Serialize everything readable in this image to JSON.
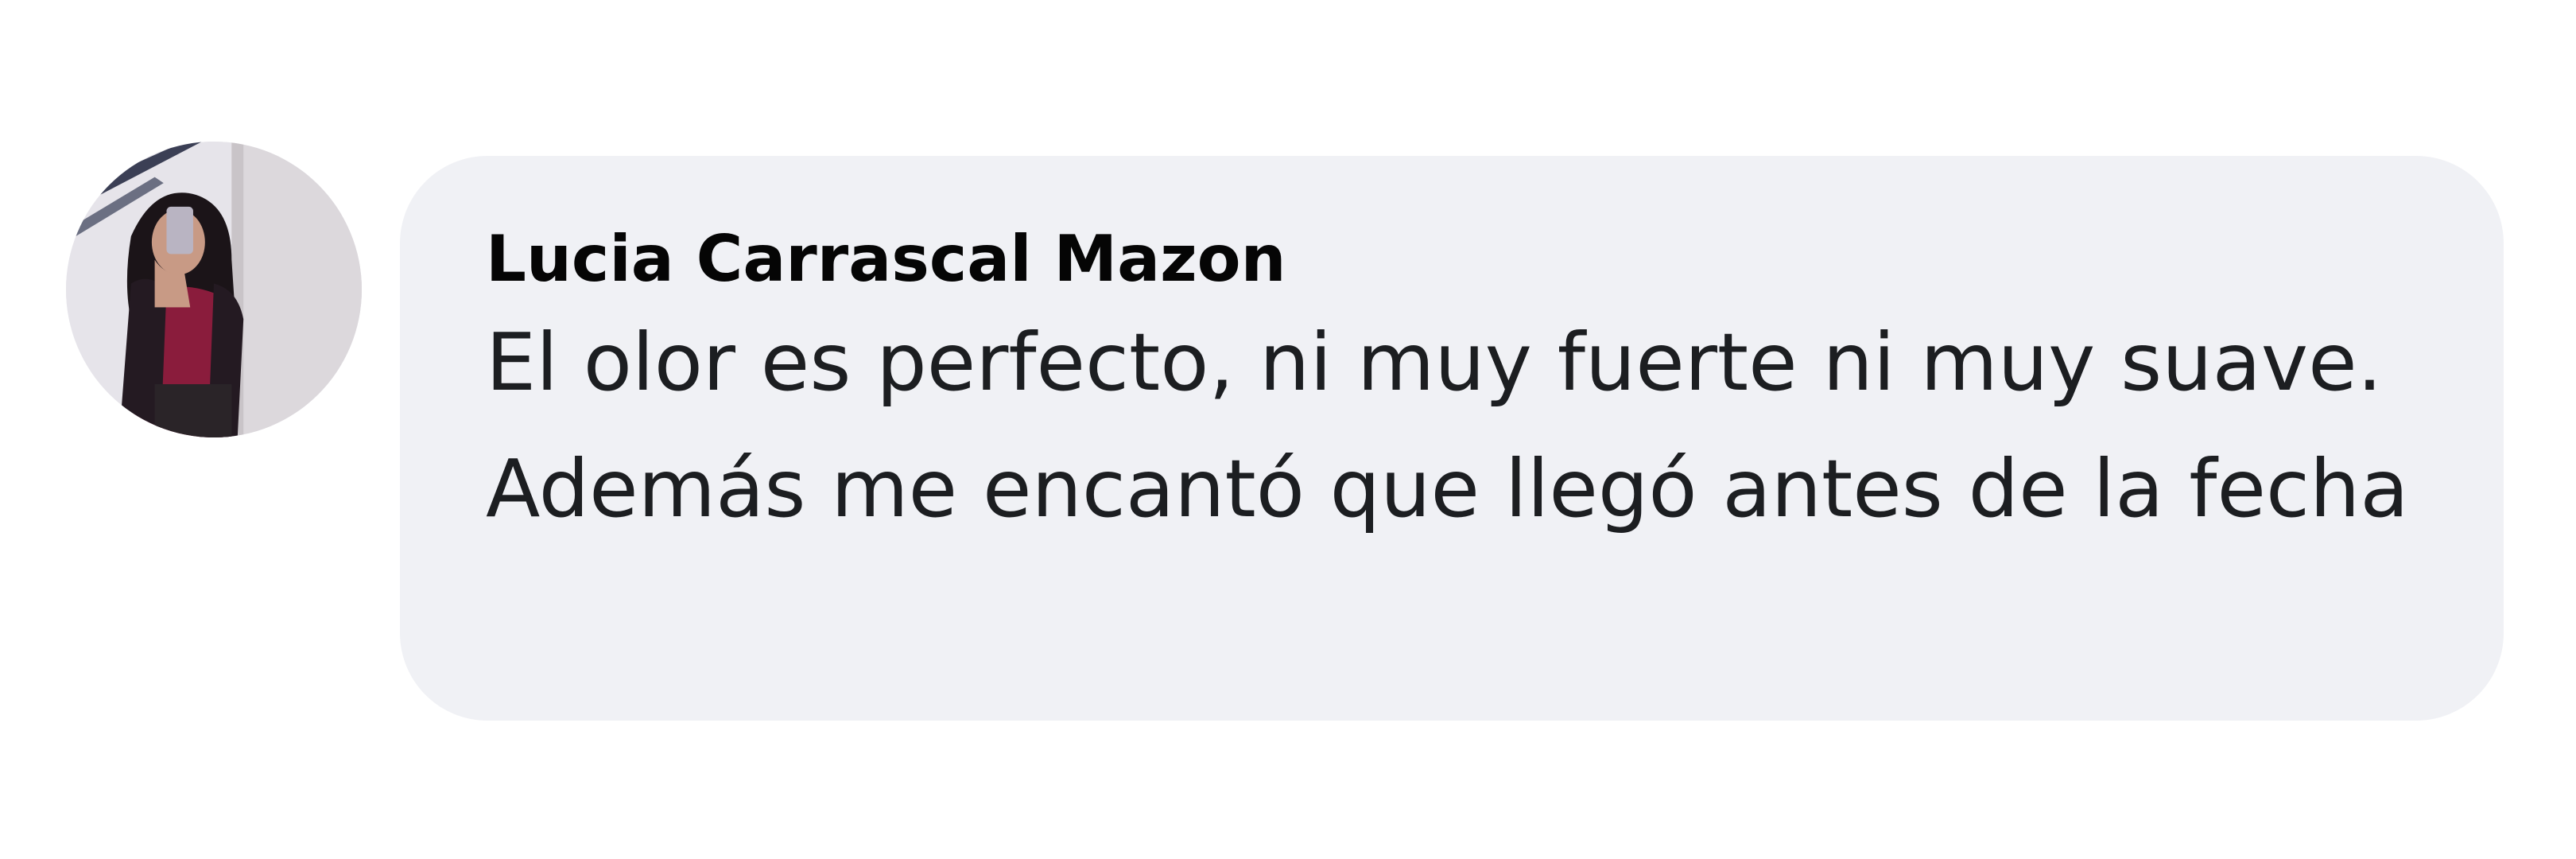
{
  "comment": {
    "author": "Lucia Carrascal Mazon",
    "text": "El olor es perfecto, ni muy fuerte ni muy suave. Además me encantó que llegó antes de la fecha"
  },
  "colors": {
    "bubble_background": "#f0f1f5",
    "author_text": "#050505",
    "body_text": "#1c1e21"
  },
  "icons": {
    "avatar": "user-profile-photo"
  }
}
